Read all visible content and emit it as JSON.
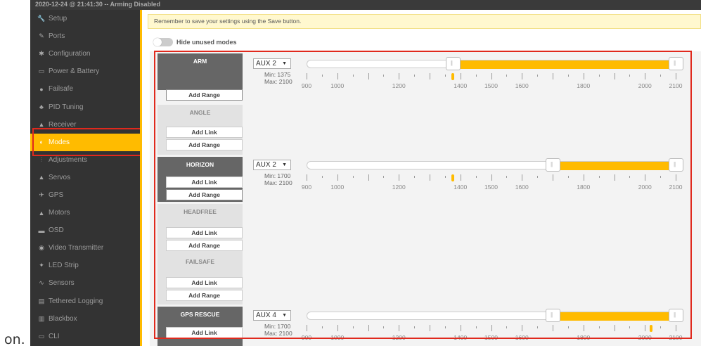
{
  "prefix_text": "on.",
  "status_bar": "2020-12-24 @ 21:41:30 -- Arming Disabled",
  "sidebar": {
    "items": [
      {
        "label": "Setup",
        "icon": "wrench-icon",
        "glyph": "🔧"
      },
      {
        "label": "Ports",
        "icon": "plug-icon",
        "glyph": "✎"
      },
      {
        "label": "Configuration",
        "icon": "gear-icon",
        "glyph": "✱"
      },
      {
        "label": "Power & Battery",
        "icon": "battery-icon",
        "glyph": "▭"
      },
      {
        "label": "Failsafe",
        "icon": "failsafe-icon",
        "glyph": "●"
      },
      {
        "label": "PID Tuning",
        "icon": "pid-icon",
        "glyph": "♣"
      },
      {
        "label": "Receiver",
        "icon": "receiver-icon",
        "glyph": "▲"
      },
      {
        "label": "Modes",
        "icon": "modes-icon",
        "glyph": "◐"
      },
      {
        "label": "Adjustments",
        "icon": "adjustments-icon",
        "glyph": "⫶"
      },
      {
        "label": "Servos",
        "icon": "servo-icon",
        "glyph": "▲"
      },
      {
        "label": "GPS",
        "icon": "gps-icon",
        "glyph": "✈"
      },
      {
        "label": "Motors",
        "icon": "motor-icon",
        "glyph": "▲"
      },
      {
        "label": "OSD",
        "icon": "osd-icon",
        "glyph": "▬"
      },
      {
        "label": "Video Transmitter",
        "icon": "vtx-icon",
        "glyph": "◉"
      },
      {
        "label": "LED Strip",
        "icon": "led-icon",
        "glyph": "✦"
      },
      {
        "label": "Sensors",
        "icon": "sensors-icon",
        "glyph": "∿"
      },
      {
        "label": "Tethered Logging",
        "icon": "logging-icon",
        "glyph": "▤"
      },
      {
        "label": "Blackbox",
        "icon": "blackbox-icon",
        "glyph": "▥"
      },
      {
        "label": "CLI",
        "icon": "cli-icon",
        "glyph": "▭"
      }
    ],
    "active": "Modes"
  },
  "notice": "Remember to save your settings using the Save button.",
  "hide_unused": "Hide unused modes",
  "buttons": {
    "add_range": "Add Range",
    "add_link": "Add Link"
  },
  "axis_labels": [
    "900",
    "1000",
    "1200",
    "1400",
    "1500",
    "1600",
    "1800",
    "2000",
    "2100"
  ],
  "modes": {
    "arm": {
      "name": "ARM",
      "channel": "AUX 2",
      "min": "Min: 1375",
      "max": "Max: 2100",
      "range": [
        1375,
        2100
      ],
      "marker": 1375
    },
    "angle": {
      "name": "ANGLE"
    },
    "horizon": {
      "name": "HORIZON",
      "channel": "AUX 2",
      "min": "Min: 1700",
      "max": "Max: 2100",
      "range": [
        1700,
        2100
      ],
      "marker": 1375
    },
    "headfree": {
      "name": "HEADFREE"
    },
    "failsafe": {
      "name": "FAILSAFE"
    },
    "gps_rescue": {
      "name": "GPS RESCUE",
      "channel": "AUX 4",
      "min": "Min: 1700",
      "max": "Max: 2100",
      "range": [
        1700,
        2100
      ],
      "marker": 2020
    }
  },
  "colors": {
    "accent": "#ffbb00",
    "highlight": "#e0291d",
    "sidebar": "#333333"
  }
}
